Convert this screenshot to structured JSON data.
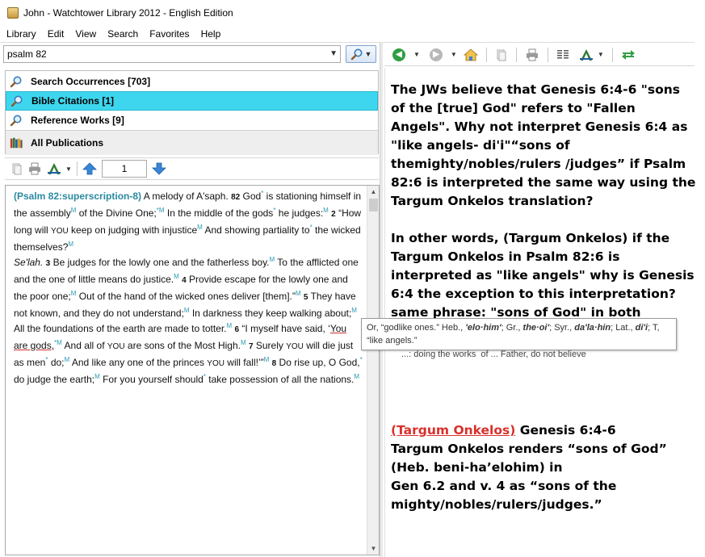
{
  "window": {
    "title": "John - Watchtower Library 2012 - English Edition"
  },
  "menu": [
    "Library",
    "Edit",
    "View",
    "Search",
    "Favorites",
    "Help"
  ],
  "search": {
    "value": "psalm 82"
  },
  "results": [
    {
      "label": "Search Occurrences [703]",
      "icon": "magnifier-icon"
    },
    {
      "label": "Bible Citations [1]",
      "icon": "magnifier-icon"
    },
    {
      "label": "Reference Works [9]",
      "icon": "magnifier-icon"
    },
    {
      "label": "All Publications",
      "icon": "books-icon"
    }
  ],
  "pager": {
    "page": "1"
  },
  "bible": {
    "ref": "(Psalm 82:superscription-8)",
    "s1": " A melody of A'saph. ",
    "v1": "82",
    "s2": " God",
    "s3": " is stationing himself in the assembly",
    "s4": " of the Divine One;",
    "s5": " In the middle of the gods",
    "s6": " he judges:",
    "v2": "2",
    "s7": " “How long will ",
    "you1": "YOU",
    "s8": " keep on judging with injustice",
    "s9": " And showing partiality to",
    "s10": " the wicked themselves?",
    "selah": "Se'lah.",
    "v3": "3",
    "s11": " Be judges for the lowly one and the fatherless boy.",
    "s12": " To the afflicted one and the one of little means do justice.",
    "v4": "4",
    "s13": " Provide escape for the lowly one and the poor one;",
    "s14": " Out of the hand of the wicked ones deliver [them].”",
    "v5": "5",
    "s15": " They have not known, and they do not understand;",
    "s16": " In darkness they keep walking about;",
    "s17": " All the foundations of the earth are made to totter.",
    "v6": "6",
    "s18": " “I myself have said, ‘",
    "gods": "You are gods,",
    "s19": " And all of ",
    "you2": "YOU",
    "s20": " are sons of the Most High.",
    "v7": "7",
    "s21": " Surely ",
    "you3": "YOU",
    "s22": " will die just as men",
    "s23": " do;",
    "s24": " And like any one of the princes ",
    "you4": "YOU",
    "s25": " will fall!’”",
    "v8": "8",
    "s26": " Do rise up, O God,",
    "s27": " do judge the earth;",
    "s28": " For you yourself should",
    "s29": " take possession of all the nations.",
    "mark": "M",
    "star": "*",
    "starm": "*M"
  },
  "tooltip": {
    "t1": "Or, “godlike ones.” Heb., ",
    "heb": "'elo·him'",
    "t2": "; Gr., ",
    "gr": "the·oi'",
    "t3": "; Syr., ",
    "syr": "da'la·hin",
    "t4": "; Lat., ",
    "lat": "di'i",
    "t5": "; T, “like angels.”"
  },
  "commentary": {
    "p1": "The JWs believe that Genesis 6:4-6 \"sons of the [true] God\" refers to \"Fallen Angels\". Why not interpret Genesis 6:4 as \"like angels- di'i\"“sons of themighty/nobles/rulers /judges” if Psalm 82:6 is interpreted the same way using the Targum Onkelos translation?",
    "p2": "In other words, (Targum Onkelos) if the Targum Onkelos in Psalm 82:6 is interpreted as           \"like angels\" why is Genesis 6:4 the exception to this interpretation?",
    "p3": "same phrase: \"sons of God\" in both instances.",
    "behind": "...: doing the works  of ... Father, do not believe",
    "targum_link": "(Targum Onkelos)",
    "targum_ref": " Genesis 6:4-6",
    "t1": "Targum Onkelos renders “sons of God”",
    "t2": "(Heb. beni-ha’elohim) in",
    "t3": "Gen 6.2 and v. 4  as “sons of the",
    "t4": "mighty/nobles/rulers/judges.”"
  },
  "colors": {
    "selected": "#3ed6ee",
    "link_red": "#d9302c",
    "ref_teal": "#2a8aa0"
  }
}
